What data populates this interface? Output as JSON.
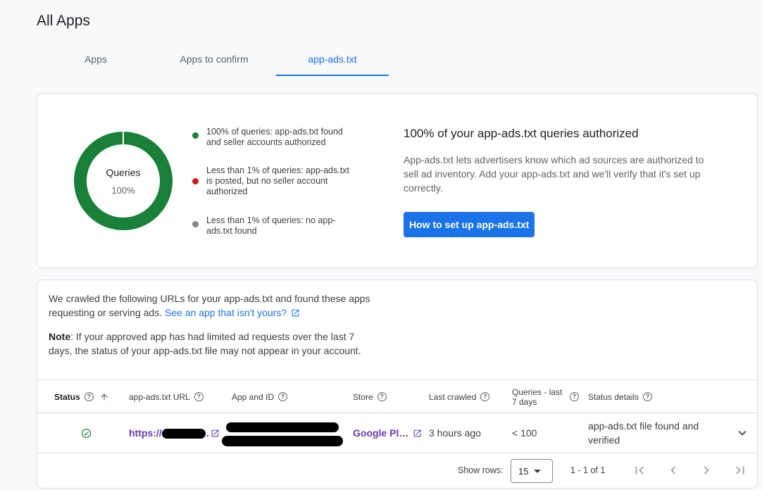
{
  "page": {
    "title": "All Apps"
  },
  "tabs": [
    {
      "label": "Apps"
    },
    {
      "label": "Apps to confirm"
    },
    {
      "label": "app-ads.txt"
    }
  ],
  "summary": {
    "donut_title": "Queries",
    "donut_value": "100%",
    "donut_fraction_authorized": 1.0,
    "legend": [
      {
        "text": "100% of queries: app-ads.txt found and seller accounts authorized",
        "color": "#188038"
      },
      {
        "text": "Less than 1% of queries: app-ads.txt is posted, but no seller account authorized",
        "color": "#c5221f"
      },
      {
        "text": "Less than 1% of queries: no app-ads.txt found",
        "color": "#80868b"
      }
    ],
    "heading": "100% of your app-ads.txt queries authorized",
    "description": "App-ads.txt lets advertisers know which ad sources are authorized to sell ad inventory. Add your app-ads.txt and we'll verify that it's set up correctly.",
    "button_label": "How to set up app-ads.txt"
  },
  "crawl": {
    "intro": "We crawled the following URLs for your app-ads.txt and found these apps requesting or serving ads.",
    "intro_link": "See an app that isn't yours?",
    "note_label": "Note",
    "note_text": ": If your approved app has had limited ad requests over the last 7 days, the status of your app-ads.txt file may not appear in your account."
  },
  "table": {
    "columns": {
      "status": "Status",
      "url": "app-ads.txt URL",
      "app": "App and ID",
      "store": "Store",
      "last_crawled": "Last crawled",
      "queries": "Queries - last 7 days",
      "status_details": "Status details"
    },
    "rows": [
      {
        "status_icon": "check-circle-icon",
        "url": "https://",
        "store": "Google Pl…",
        "last_crawled": "3 hours ago",
        "queries": "< 100",
        "status_details": "app-ads.txt file found and verified"
      }
    ]
  },
  "pagination": {
    "show_rows_label": "Show rows:",
    "rows_value": "15",
    "range": "1 - 1 of 1"
  },
  "colors": {
    "accent": "#1a73e8",
    "success": "#188038",
    "link_purple": "#673ab7"
  }
}
